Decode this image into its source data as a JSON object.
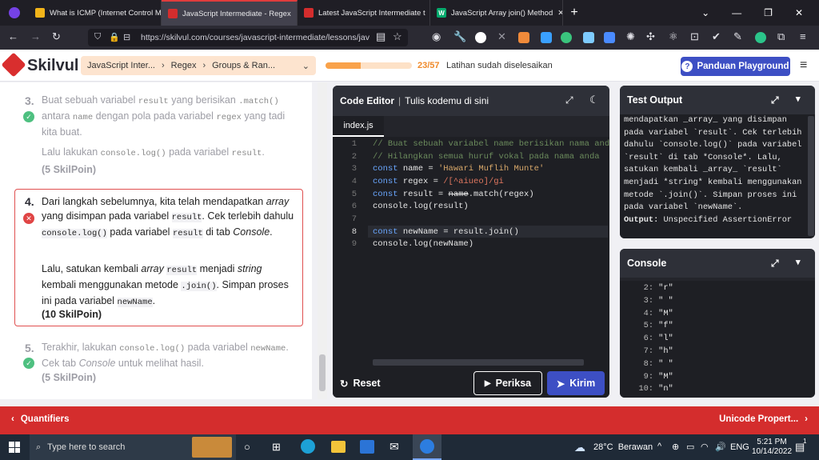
{
  "browser": {
    "tabs": [
      {
        "title": "What is ICMP (Internet Control M",
        "favicon": "#f2b41a"
      },
      {
        "title": "JavaScript Intermediate - Regex",
        "favicon": "#d42d2d"
      },
      {
        "title": "Latest JavaScript Intermediate t",
        "favicon": "#d42d2d"
      },
      {
        "title": "JavaScript Array join() Method",
        "favicon": "#04aa6d"
      }
    ],
    "url": "https://skilvul.com/courses/javascript-intermediate/lessons/jav"
  },
  "header": {
    "logo": "Skilvul",
    "breadcrumb": [
      "JavaScript Inter...",
      "Regex",
      "Groups & Ran..."
    ],
    "progress_text": "23/57",
    "progress_fraction": 0.4035,
    "progress_label": "Latihan sudah diselesaikan",
    "guide_button": "Panduan Playground"
  },
  "lesson": {
    "step3": {
      "num": "3.",
      "p1a": "Buat sebuah variabel ",
      "p1code1": "result",
      "p1b": " yang berisikan ",
      "p1code2": ".match()",
      "p1c": " antara ",
      "p1code3": "name",
      "p1d": " dengan pola pada variabel ",
      "p1code4": "regex",
      "p1e": " yang tadi kita buat.",
      "p2a": "Lalu lakukan ",
      "p2code1": "console.log()",
      "p2b": " pada variabel ",
      "p2code2": "result",
      "p2c": ".",
      "points": "(5 SkilPoin)"
    },
    "step4": {
      "num": "4.",
      "p1a": "Dari langkah sebelumnya, kita telah mendapatkan ",
      "p1em1": "array",
      "p1b": " yang disimpan pada variabel ",
      "p1code1": "result",
      "p1c": ". Cek terlebih dahulu ",
      "p1code2": "console.log()",
      "p1d": " pada variabel ",
      "p1code3": "result",
      "p1e": " di tab ",
      "p1em2": "Console",
      "p1f": ".",
      "p2a": "Lalu, satukan kembali ",
      "p2em1": "array",
      "p2code1": "result",
      "p2b": " menjadi ",
      "p2em2": "string",
      "p2c": " kembali menggunakan metode ",
      "p2code2": ".join()",
      "p2d": ". Simpan proses ini pada variabel ",
      "p2code3": "newName",
      "p2e": ".",
      "points": "(10 SkilPoin)"
    },
    "step5": {
      "num": "5.",
      "p1a": "Terakhir, lakukan ",
      "p1code1": "console.log()",
      "p1b": " pada variabel ",
      "p1code2": "newName",
      "p1c": ". Cek tab ",
      "p1em1": "Console",
      "p1d": " untuk melihat hasil.",
      "points": "(5 SkilPoin)"
    }
  },
  "editor": {
    "title": "Code Editor",
    "subtitle": "Tulis kodemu di sini",
    "file": "index.js",
    "line_numbers": [
      "1",
      "2",
      "3",
      "4",
      "5",
      "6",
      "7",
      "8",
      "9"
    ],
    "lines": [
      {
        "a": "// Buat sebuah variabel name berisikan nama anda"
      },
      {
        "a": "// Hilangkan semua huruf vokal pada nama anda"
      },
      {
        "kw": "const",
        "b": " name = ",
        "str": "'Hawari Muflih Munte'"
      },
      {
        "kw": "const",
        "b": " regex = ",
        "re": "/[^aiueo]/gi"
      },
      {
        "kw": "const",
        "b": " result = ",
        "strike": "name",
        "c": ".match(regex)"
      },
      {
        "b": "console.log(result)"
      },
      {
        "b": ""
      },
      {
        "kw": "const",
        "b": " newName = result.join()"
      },
      {
        "b": "console.log(newName)"
      }
    ],
    "reset": "Reset",
    "check": "Periksa",
    "send": "Kirim"
  },
  "test_output": {
    "title": "Test Output",
    "lines": [
      "mendapatkan _array_ yang disimpan",
      "pada variabel `result`. Cek terlebih",
      "dahulu `console.log()` pada variabel",
      "`result` di tab *Console*. Lalu,",
      "satukan kembali _array_ `result`",
      "menjadi *string* kembali menggunakan",
      "metode `.join()`. Simpan proses ini",
      "pada variabel `newName`."
    ],
    "output_label": "Output:",
    "output_value": " Unspecified AssertionError"
  },
  "console": {
    "title": "Console",
    "rows": [
      {
        "i": "2:",
        "v": "\"r\""
      },
      {
        "i": "3:",
        "v": "\" \""
      },
      {
        "i": "4:",
        "v": "\"M\""
      },
      {
        "i": "5:",
        "v": "\"f\""
      },
      {
        "i": "6:",
        "v": "\"l\""
      },
      {
        "i": "7:",
        "v": "\"h\""
      },
      {
        "i": "8:",
        "v": "\" \""
      },
      {
        "i": "9:",
        "v": "\"M\""
      },
      {
        "i": "10:",
        "v": "\"n\""
      }
    ]
  },
  "footer_nav": {
    "prev": "Quantifiers",
    "next": "Unicode Propert..."
  },
  "taskbar": {
    "search": "Type here to search",
    "weather": "28°C  Berawan",
    "lang": "ENG",
    "time": "5:21 PM",
    "date": "10/14/2022",
    "notifications": "1"
  }
}
